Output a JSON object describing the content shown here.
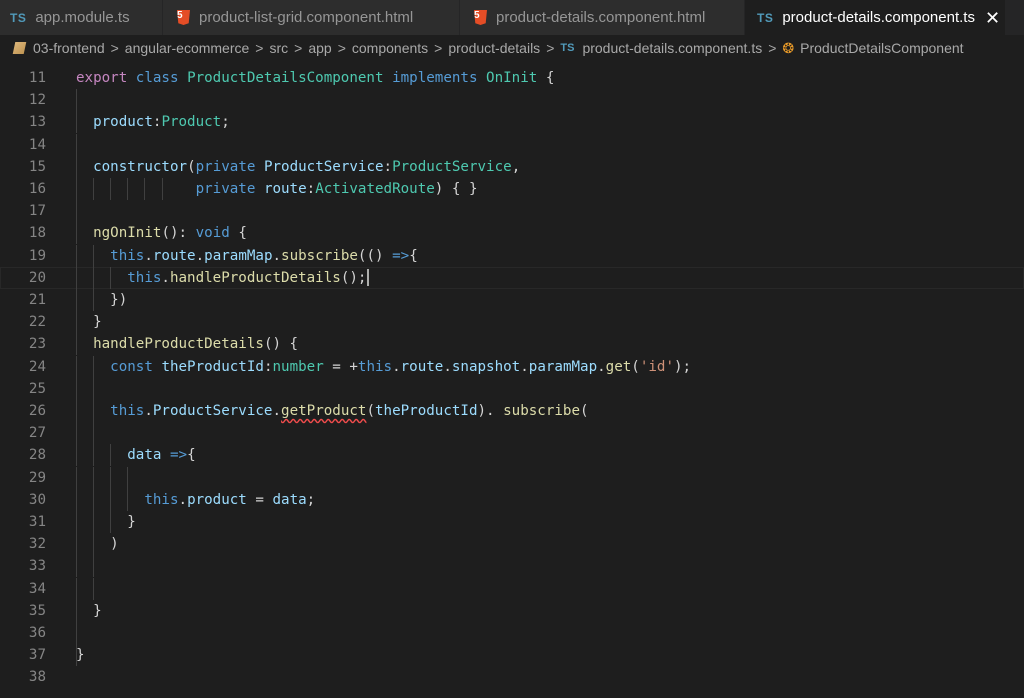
{
  "tabs": [
    {
      "icon": "TS",
      "label": "app.module.ts",
      "active": false
    },
    {
      "icon": "5",
      "label": "product-list-grid.component.html",
      "active": false
    },
    {
      "icon": "5",
      "label": "product-details.component.html",
      "active": false
    },
    {
      "icon": "TS",
      "label": "product-details.component.ts",
      "active": true,
      "close": "✕"
    }
  ],
  "breadcrumb": {
    "items": [
      "03-frontend",
      "angular-ecommerce",
      "src",
      "app",
      "components",
      "product-details"
    ],
    "file_icon": "TS",
    "file": "product-details.component.ts",
    "symbol": "ProductDetailsComponent",
    "separator": ">"
  },
  "editor": {
    "cursor_line": 20,
    "lines": [
      {
        "n": "11",
        "tokens": [
          [
            "kw2",
            "export"
          ],
          [
            "pun",
            " "
          ],
          [
            "kw",
            "class"
          ],
          [
            "pun",
            " "
          ],
          [
            "ty",
            "ProductDetailsComponent"
          ],
          [
            "pun",
            " "
          ],
          [
            "kw",
            "implements"
          ],
          [
            "pun",
            " "
          ],
          [
            "ty",
            "OnInit"
          ],
          [
            "pun",
            " {"
          ]
        ]
      },
      {
        "n": "12",
        "tokens": []
      },
      {
        "n": "13",
        "tokens": [
          [
            "pun",
            "  "
          ],
          [
            "var",
            "product"
          ],
          [
            "pun",
            ":"
          ],
          [
            "ty",
            "Product"
          ],
          [
            "pun",
            ";"
          ]
        ]
      },
      {
        "n": "14",
        "tokens": []
      },
      {
        "n": "15",
        "tokens": [
          [
            "pun",
            "  "
          ],
          [
            "var",
            "constructor"
          ],
          [
            "pun",
            "("
          ],
          [
            "kw",
            "private"
          ],
          [
            "pun",
            " "
          ],
          [
            "var",
            "ProductService"
          ],
          [
            "pun",
            ":"
          ],
          [
            "ty",
            "ProductService"
          ],
          [
            "pun",
            ","
          ]
        ]
      },
      {
        "n": "16",
        "tokens": [
          [
            "pun",
            "              "
          ],
          [
            "kw",
            "private"
          ],
          [
            "pun",
            " "
          ],
          [
            "var",
            "route"
          ],
          [
            "pun",
            ":"
          ],
          [
            "ty",
            "ActivatedRoute"
          ],
          [
            "pun",
            ") { }"
          ]
        ]
      },
      {
        "n": "17",
        "tokens": []
      },
      {
        "n": "18",
        "tokens": [
          [
            "pun",
            "  "
          ],
          [
            "fn",
            "ngOnInit"
          ],
          [
            "pun",
            "(): "
          ],
          [
            "kw",
            "void"
          ],
          [
            "pun",
            " {"
          ]
        ]
      },
      {
        "n": "19",
        "tokens": [
          [
            "pun",
            "    "
          ],
          [
            "kw",
            "this"
          ],
          [
            "pun",
            "."
          ],
          [
            "var",
            "route"
          ],
          [
            "pun",
            "."
          ],
          [
            "var",
            "paramMap"
          ],
          [
            "pun",
            "."
          ],
          [
            "fn",
            "subscribe"
          ],
          [
            "pun",
            "(() "
          ],
          [
            "kw",
            "=>"
          ],
          [
            "pun",
            "{"
          ]
        ]
      },
      {
        "n": "20",
        "tokens": [
          [
            "pun",
            "      "
          ],
          [
            "kw",
            "this"
          ],
          [
            "pun",
            "."
          ],
          [
            "fn",
            "handleProductDetails"
          ],
          [
            "pun",
            "();"
          ]
        ]
      },
      {
        "n": "21",
        "tokens": [
          [
            "pun",
            "    })"
          ]
        ]
      },
      {
        "n": "22",
        "tokens": [
          [
            "pun",
            "  }"
          ]
        ]
      },
      {
        "n": "23",
        "tokens": [
          [
            "pun",
            "  "
          ],
          [
            "fn",
            "handleProductDetails"
          ],
          [
            "pun",
            "() {"
          ]
        ]
      },
      {
        "n": "24",
        "tokens": [
          [
            "pun",
            "    "
          ],
          [
            "kw",
            "const"
          ],
          [
            "pun",
            " "
          ],
          [
            "var",
            "theProductId"
          ],
          [
            "pun",
            ":"
          ],
          [
            "ty",
            "number"
          ],
          [
            "pun",
            " = +"
          ],
          [
            "kw",
            "this"
          ],
          [
            "pun",
            "."
          ],
          [
            "var",
            "route"
          ],
          [
            "pun",
            "."
          ],
          [
            "var",
            "snapshot"
          ],
          [
            "pun",
            "."
          ],
          [
            "var",
            "paramMap"
          ],
          [
            "pun",
            "."
          ],
          [
            "fn",
            "get"
          ],
          [
            "pun",
            "("
          ],
          [
            "str",
            "'id'"
          ],
          [
            "pun",
            ");"
          ]
        ]
      },
      {
        "n": "25",
        "tokens": []
      },
      {
        "n": "26",
        "tokens": [
          [
            "pun",
            "    "
          ],
          [
            "kw",
            "this"
          ],
          [
            "pun",
            "."
          ],
          [
            "var",
            "ProductService"
          ],
          [
            "pun",
            "."
          ],
          [
            "fn",
            "getProduct"
          ],
          [
            "pun",
            "("
          ],
          [
            "var",
            "theProductId"
          ],
          [
            "pun",
            "). "
          ],
          [
            "fn",
            "subscribe"
          ],
          [
            "pun",
            "("
          ]
        ]
      },
      {
        "n": "27",
        "tokens": []
      },
      {
        "n": "28",
        "tokens": [
          [
            "pun",
            "      "
          ],
          [
            "var",
            "data"
          ],
          [
            "pun",
            " "
          ],
          [
            "kw",
            "=>"
          ],
          [
            "pun",
            "{"
          ]
        ]
      },
      {
        "n": "29",
        "tokens": []
      },
      {
        "n": "30",
        "tokens": [
          [
            "pun",
            "        "
          ],
          [
            "kw",
            "this"
          ],
          [
            "pun",
            "."
          ],
          [
            "var",
            "product"
          ],
          [
            "pun",
            " = "
          ],
          [
            "var",
            "data"
          ],
          [
            "pun",
            ";"
          ]
        ]
      },
      {
        "n": "31",
        "tokens": [
          [
            "pun",
            "      }"
          ]
        ]
      },
      {
        "n": "32",
        "tokens": [
          [
            "pun",
            "    )"
          ]
        ]
      },
      {
        "n": "33",
        "tokens": []
      },
      {
        "n": "34",
        "tokens": []
      },
      {
        "n": "35",
        "tokens": [
          [
            "pun",
            "  }"
          ]
        ]
      },
      {
        "n": "36",
        "tokens": []
      },
      {
        "n": "37",
        "tokens": [
          [
            "pun",
            "}"
          ]
        ]
      },
      {
        "n": "38",
        "tokens": []
      }
    ]
  }
}
